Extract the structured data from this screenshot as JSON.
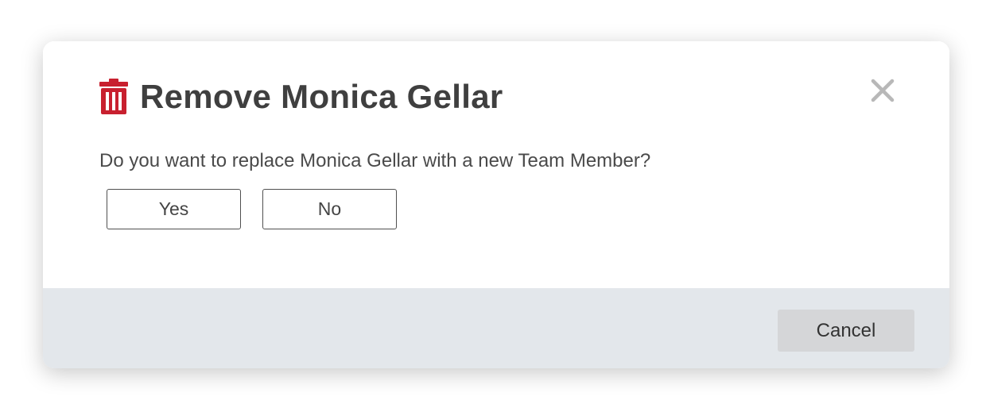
{
  "dialog": {
    "title": "Remove Monica Gellar",
    "title_icon": "trash-icon",
    "close_icon": "close-icon",
    "question": "Do you want to replace Monica Gellar with a new Team Member?",
    "yes_label": "Yes",
    "no_label": "No",
    "cancel_label": "Cancel"
  },
  "colors": {
    "icon_red": "#c8202f",
    "title_text": "#3f3f3f",
    "footer_bg": "#e3e7eb",
    "cancel_bg": "#d5d6d8",
    "close_gray": "#b8b8b8"
  }
}
